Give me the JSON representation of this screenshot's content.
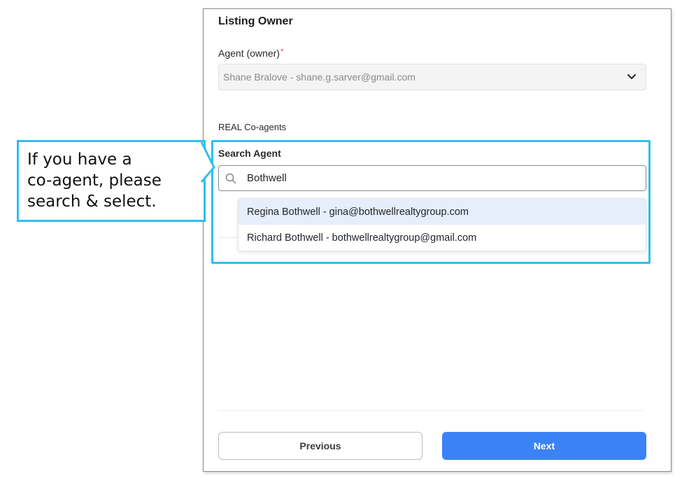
{
  "form": {
    "section_title": "Listing Owner",
    "agent_label": "Agent (owner)",
    "required_marker": "*",
    "owner_value": "Shane Bralove - shane.g.sarver@gmail.com",
    "coagents_label": "REAL Co-agents",
    "search_label": "Search Agent",
    "search_value": "Bothwell",
    "results": [
      "Regina Bothwell - gina@bothwellrealtygroup.com",
      "Richard Bothwell - bothwellrealtygroup@gmail.com"
    ],
    "previous_label": "Previous",
    "next_label": "Next"
  },
  "annotation": {
    "text": "If you have a\nco-agent, please\nsearch & select.",
    "color": "#2fc0ea"
  },
  "icons": {
    "owner_select": "chevron-down-icon",
    "search": "search-icon"
  },
  "colors": {
    "primary": "#3b82f6",
    "highlight_option": "#e6eefb",
    "required": "#e0344b"
  }
}
